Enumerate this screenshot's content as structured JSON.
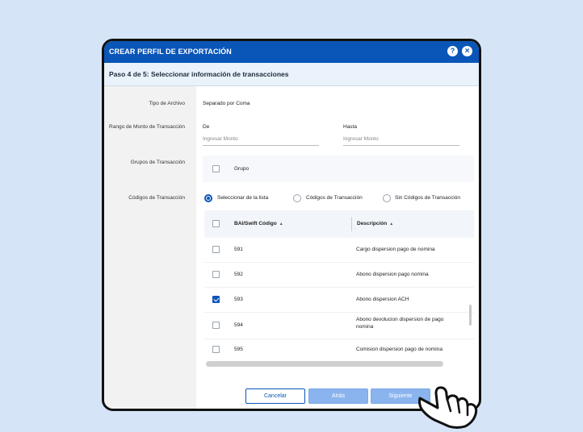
{
  "dialog": {
    "title": "CREAR PERFIL DE EXPORTACIÓN",
    "help_icon": "help-circle-icon",
    "close_icon": "close-circle-icon",
    "step": "Paso 4 de 5: Seleccionar información de transacciones"
  },
  "form": {
    "file_type": {
      "label": "Tipo de Archivo",
      "value": "Separado por Coma"
    },
    "amount_range": {
      "label": "Rango de Monto de Transacción",
      "from_label": "De",
      "from_placeholder": "Ingresar Monto",
      "to_label": "Hasta",
      "to_placeholder": "Ingresar Monto"
    },
    "groups": {
      "label": "Grupos de Transacción",
      "option": "Grupo",
      "checked": false
    },
    "codes": {
      "label": "Códigos de Transacción",
      "radio_options": [
        "Seleccionar de la lista",
        "Códigos de Transacción",
        "Sin Códigos de Transacción"
      ],
      "selected_index": 0
    }
  },
  "table": {
    "headers": [
      "BAI/Swift Código",
      "Descripción"
    ],
    "rows": [
      {
        "code": "591",
        "desc": "Cargo dispersion pago de nomina",
        "checked": false
      },
      {
        "code": "592",
        "desc": "Abono dispersion pago nomina",
        "checked": false
      },
      {
        "code": "593",
        "desc": "Abono dispersion ACH",
        "checked": true
      },
      {
        "code": "594",
        "desc": "Abono devolucion dispersion de pago nomina",
        "checked": false
      },
      {
        "code": "595",
        "desc": "Comision dispersion pago de nomina",
        "checked": false
      }
    ]
  },
  "buttons": {
    "cancel": "Cancelar",
    "back": "Atrás",
    "next": "Siguiente"
  },
  "colors": {
    "primary": "#0a56b8",
    "background": "#d5e5f7",
    "button_disabled": "#8ab4ee"
  }
}
